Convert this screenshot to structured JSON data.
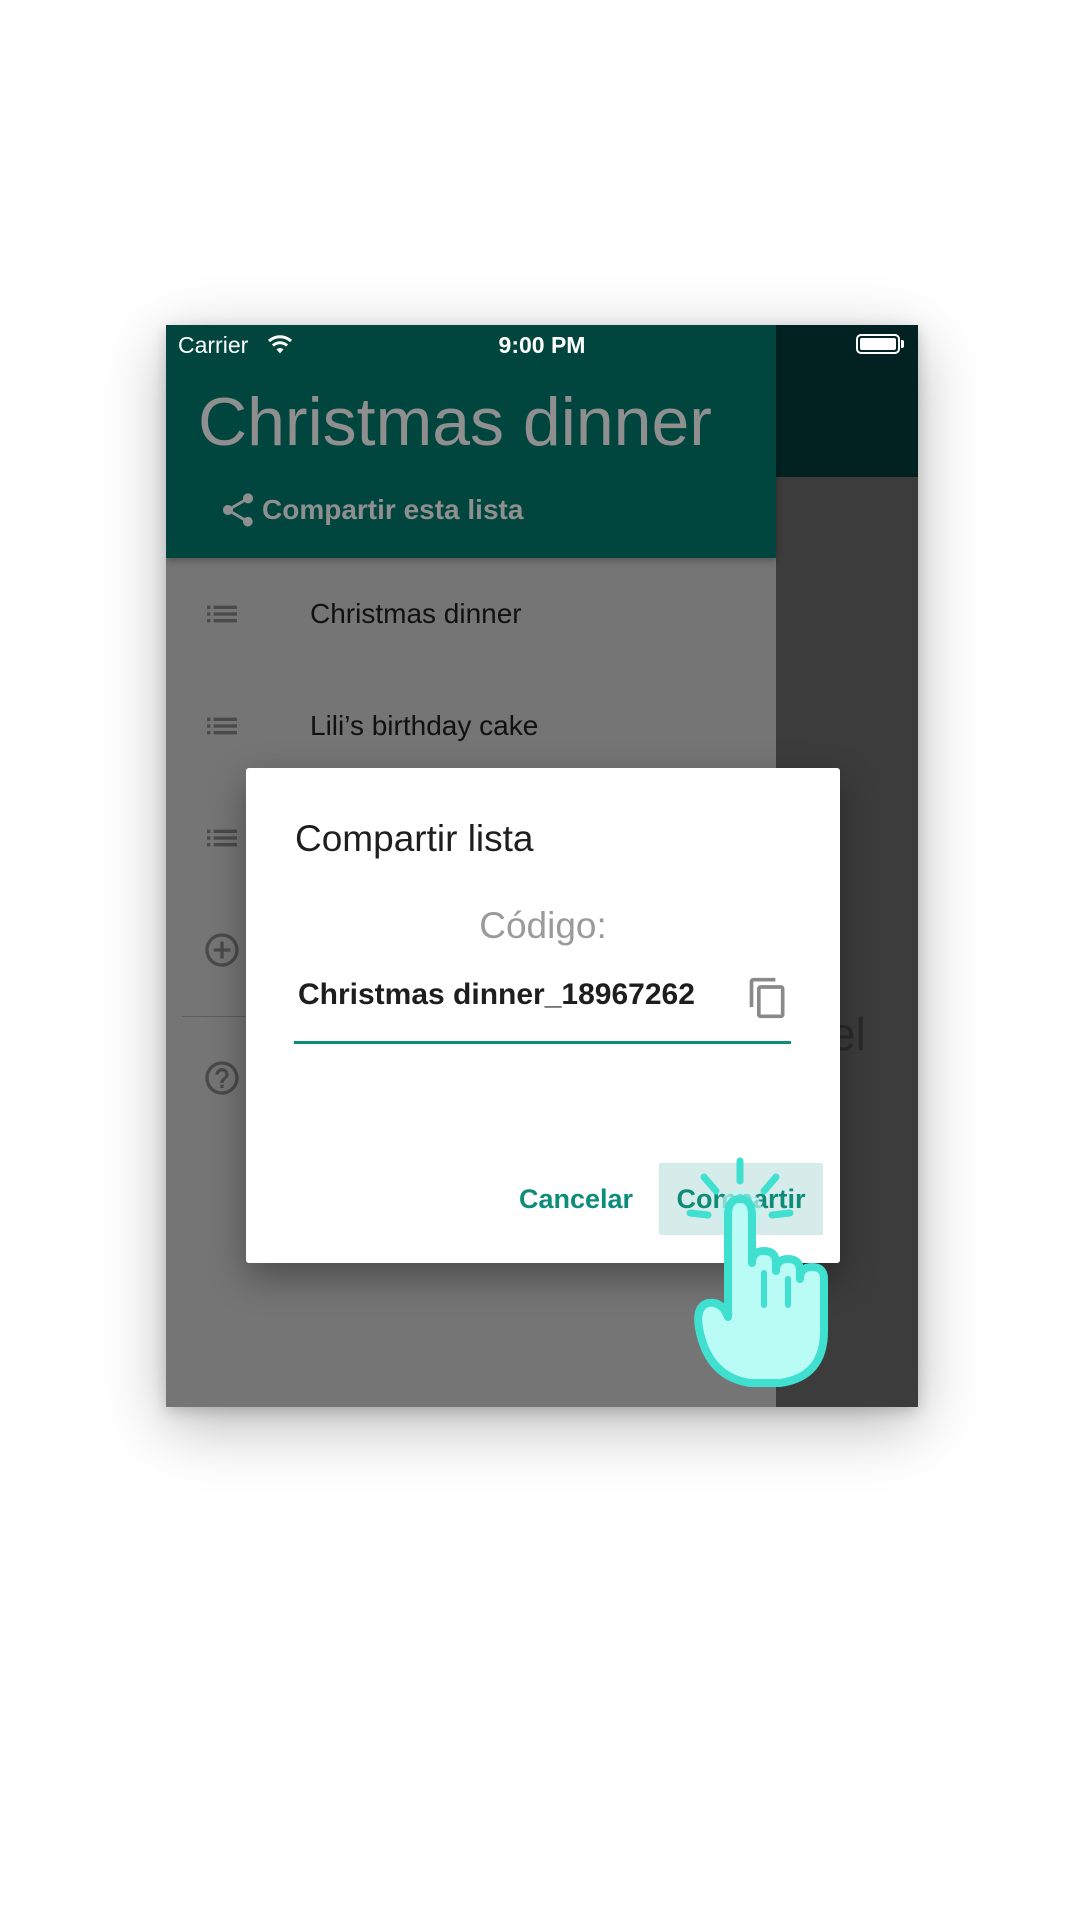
{
  "status_bar": {
    "carrier": "Carrier",
    "time": "9:00 PM"
  },
  "drawer": {
    "title": "Christmas dinner",
    "share_label": "Compartir esta lista",
    "lists": [
      {
        "label": "Christmas dinner",
        "icon": "list-icon"
      },
      {
        "label": "Lili’s birthday cake",
        "icon": "list-icon"
      }
    ]
  },
  "background": {
    "partial_text": "el"
  },
  "dialog": {
    "title": "Compartir lista",
    "code_label": "Código:",
    "code_value": "Christmas dinner_18967262",
    "cancel_label": "Cancelar",
    "share_label": "Compartir",
    "accent_color": "#0e8c7a"
  },
  "colors": {
    "header_bg": "#01463e",
    "drawer_overlay": "#757575",
    "pointer": "#3fe0d0"
  }
}
